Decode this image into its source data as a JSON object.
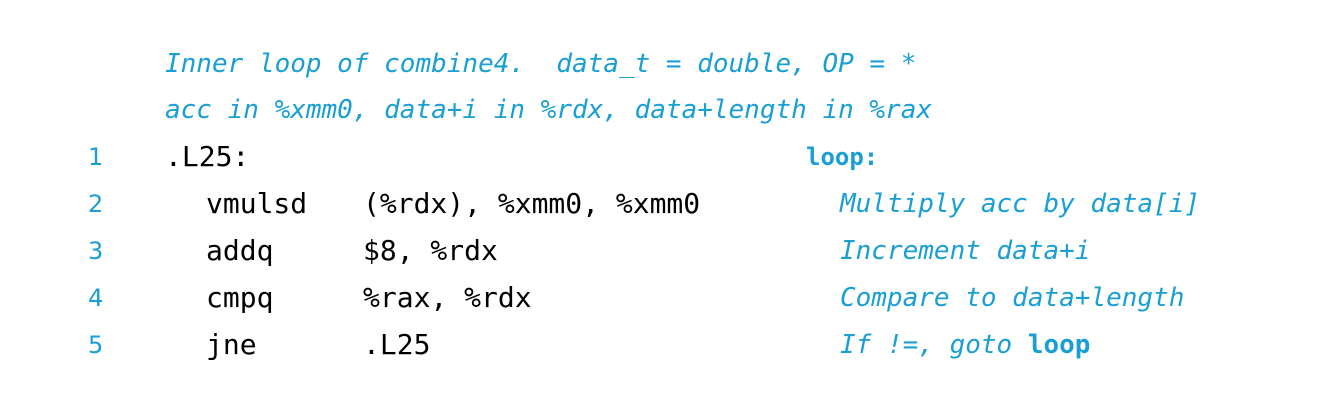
{
  "colors": {
    "accent": "#1a9fd4",
    "code": "#000000",
    "background": "#ffffff"
  },
  "header": {
    "comment_1": "Inner loop of combine4.  data_t = double, OP = *",
    "comment_2": "acc in %xmm0, data+i in %rdx, data+length in %rax"
  },
  "lines": [
    {
      "number": "1",
      "label": ".L25:",
      "annotation": "loop:"
    },
    {
      "number": "2",
      "op": "vmulsd",
      "args": "(%rdx), %xmm0, %xmm0",
      "comment": "Multiply acc by data[i]"
    },
    {
      "number": "3",
      "op": "addq",
      "args": "$8, %rdx",
      "comment": "Increment data+i"
    },
    {
      "number": "4",
      "op": "cmpq",
      "args": "%rax, %rdx",
      "comment": "Compare to data+length"
    },
    {
      "number": "5",
      "op": "jne",
      "args": ".L25",
      "comment": "If !=, goto",
      "comment_keyword": "loop"
    }
  ]
}
